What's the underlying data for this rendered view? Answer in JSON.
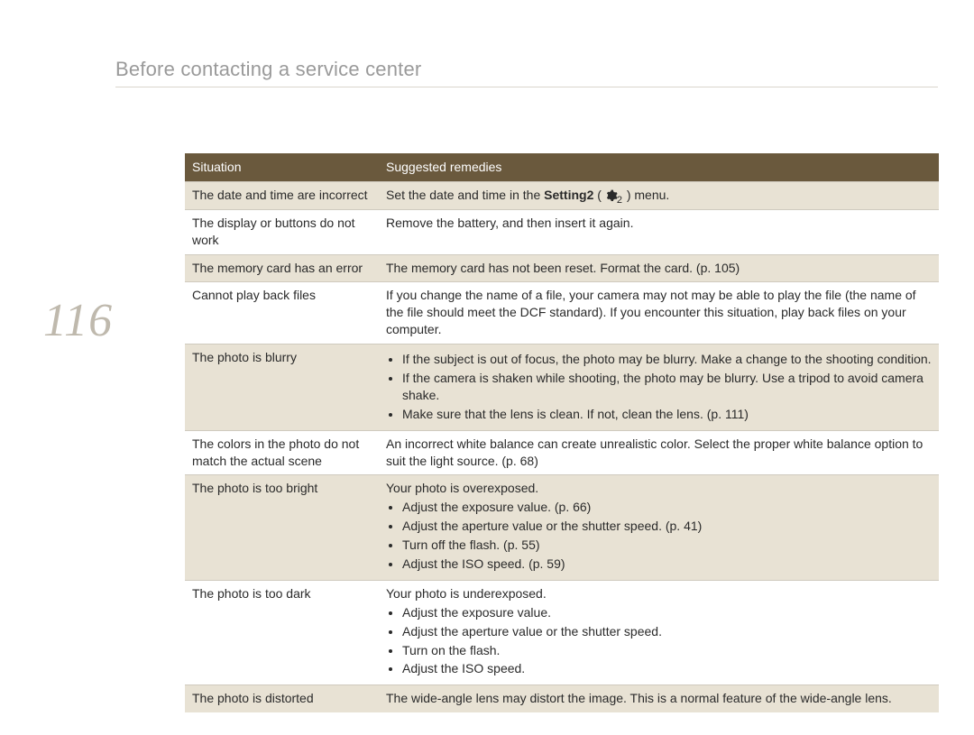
{
  "page_title": "Before contacting a service center",
  "page_number": "116",
  "table": {
    "header_situation": "Situation",
    "header_remedies": "Suggested remedies",
    "rows": [
      {
        "alt": true,
        "situation": "The date and time are incorrect",
        "remedy_type": "composite",
        "remedy_pre": "Set the date and time in the ",
        "remedy_bold": "Setting2",
        "remedy_mid": " ( ",
        "remedy_sub": "2",
        "remedy_post": " ) menu."
      },
      {
        "alt": false,
        "situation": "The display or buttons do not work",
        "remedy_type": "text",
        "remedy": "Remove the battery, and then insert it again."
      },
      {
        "alt": true,
        "situation": "The memory card has an error",
        "remedy_type": "text",
        "remedy": "The memory card has not been reset. Format the card. (p. 105)"
      },
      {
        "alt": false,
        "situation": "Cannot play back files",
        "remedy_type": "text",
        "remedy": "If you change the name of a file, your camera may not may be able to play the file (the name of the file should meet the DCF standard). If you encounter this situation, play back files on your computer."
      },
      {
        "alt": true,
        "situation": "The photo is blurry",
        "remedy_type": "list",
        "remedy_items": [
          "If the subject is out of focus, the photo may be blurry. Make a change to the shooting condition.",
          "If the camera is shaken while shooting, the photo may be blurry. Use a tripod to avoid camera shake.",
          "Make sure that the lens is clean. If not, clean the lens. (p. 111)"
        ]
      },
      {
        "alt": false,
        "situation": "The colors in the photo do not match the actual scene",
        "remedy_type": "text",
        "remedy": "An incorrect white balance can create unrealistic color. Select the proper white balance option to suit the light source. (p. 68)"
      },
      {
        "alt": true,
        "situation": "The photo is too bright",
        "remedy_type": "intro_list",
        "remedy_intro": "Your photo is overexposed.",
        "remedy_items": [
          "Adjust the exposure value. (p. 66)",
          "Adjust the aperture value or the shutter speed. (p. 41)",
          "Turn off the flash. (p. 55)",
          "Adjust the ISO speed. (p. 59)"
        ]
      },
      {
        "alt": false,
        "situation": "The photo is too dark",
        "remedy_type": "intro_list",
        "remedy_intro": "Your photo is underexposed.",
        "remedy_items": [
          "Adjust the exposure value.",
          "Adjust the aperture value or the shutter speed.",
          "Turn on the flash.",
          "Adjust the ISO speed."
        ]
      },
      {
        "alt": true,
        "situation": "The photo is distorted",
        "remedy_type": "text",
        "remedy": "The wide-angle lens may distort the image. This is a normal feature of the wide-angle lens."
      }
    ]
  }
}
